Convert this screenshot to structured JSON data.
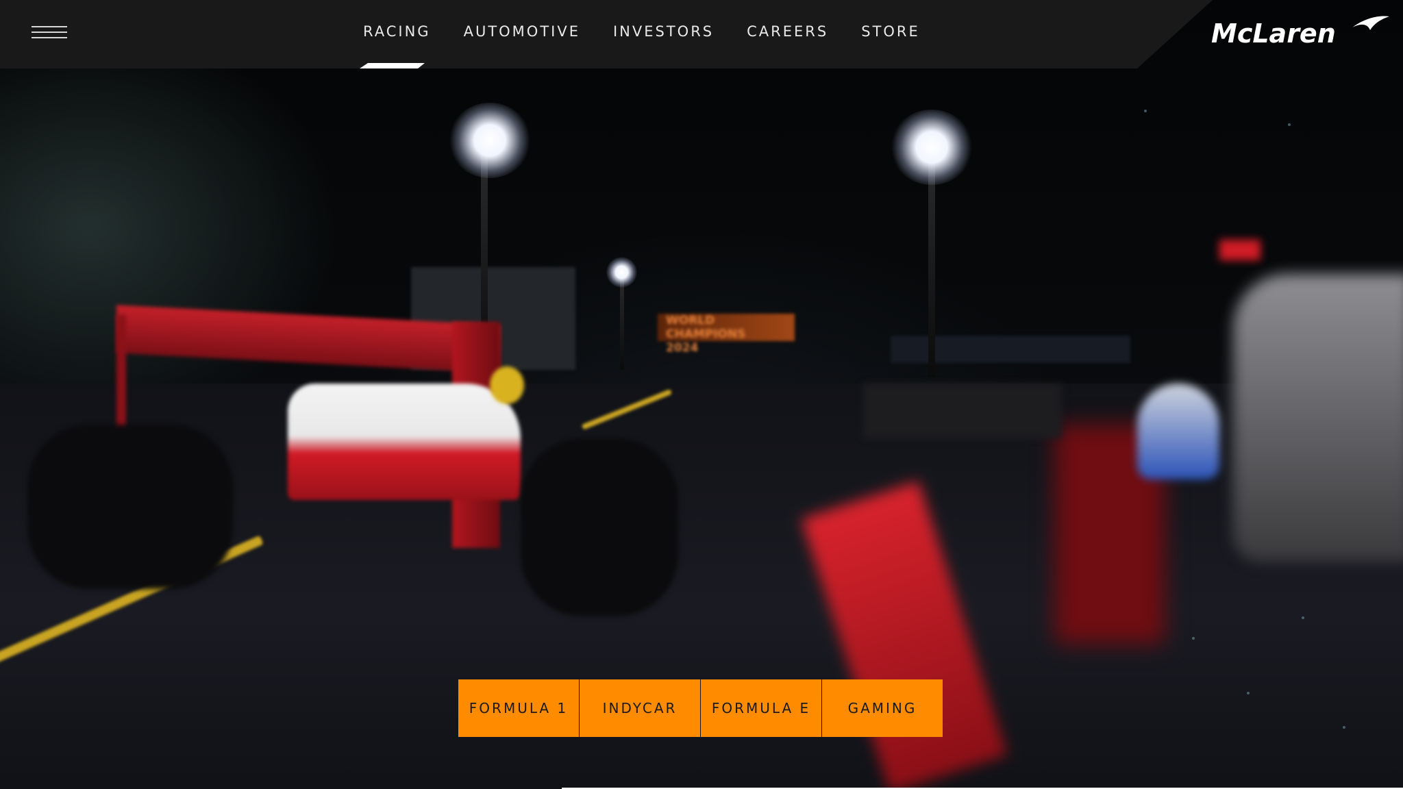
{
  "nav": {
    "menu_icon": "hamburger-menu-icon",
    "links": [
      {
        "label": "RACING",
        "active": true
      },
      {
        "label": "AUTOMOTIVE",
        "active": false
      },
      {
        "label": "INVESTORS",
        "active": false
      },
      {
        "label": "CAREERS",
        "active": false
      },
      {
        "label": "STORE",
        "active": false
      }
    ]
  },
  "brand": {
    "logo_text": "McLaren",
    "logo_icon": "mclaren-speedmark-icon"
  },
  "hero": {
    "banner_line1": "WORLD CHAMPIONS",
    "banner_line2": "2024"
  },
  "cta": {
    "buttons": [
      {
        "label": "FORMULA 1"
      },
      {
        "label": "INDYCAR"
      },
      {
        "label": "FORMULA E"
      },
      {
        "label": "GAMING"
      }
    ]
  },
  "colors": {
    "accent": "#ff8c00",
    "topbar": "#191919",
    "nav_text": "#e9e9e9"
  }
}
